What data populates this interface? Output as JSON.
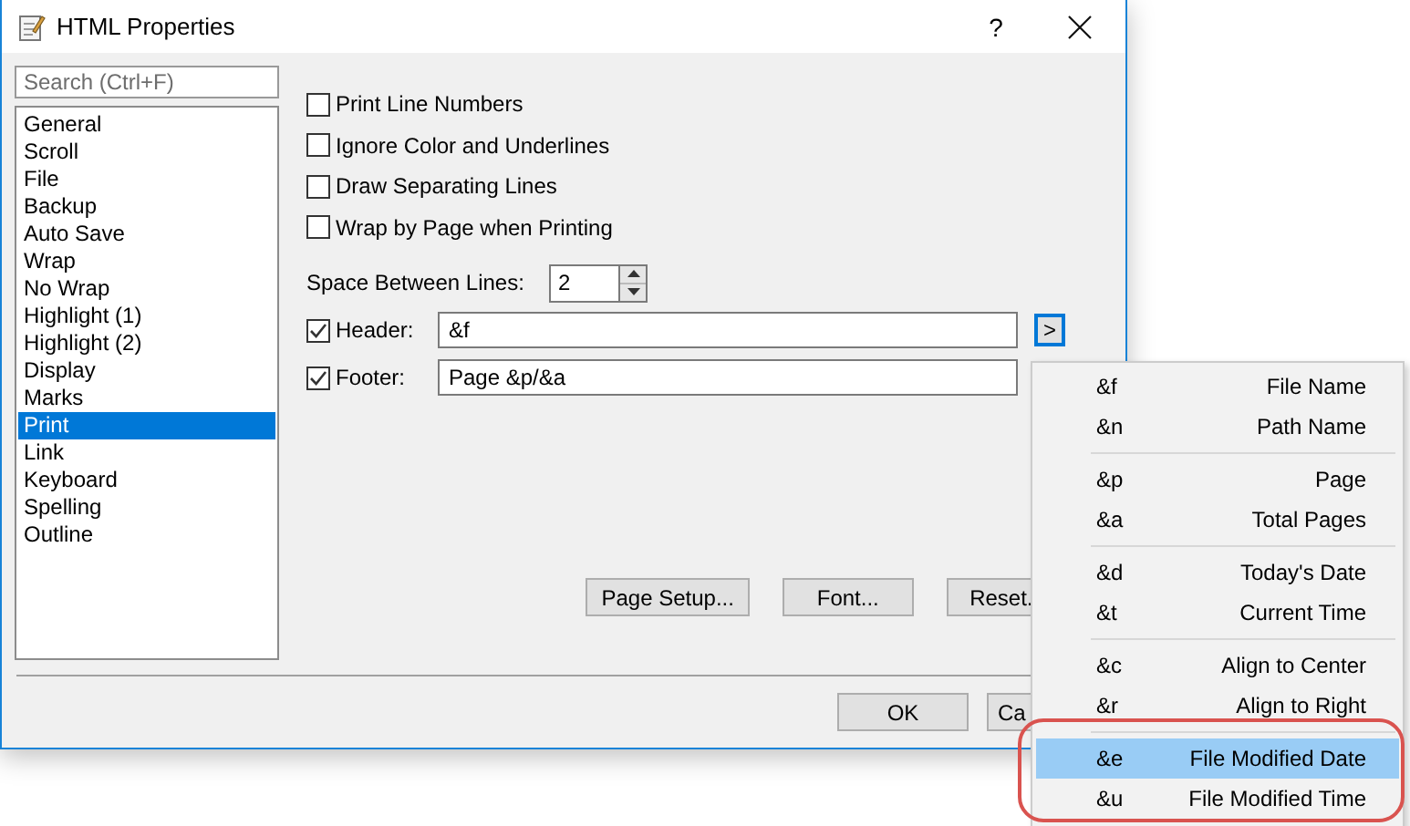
{
  "window": {
    "title": "HTML Properties",
    "help": "?"
  },
  "search": {
    "placeholder": "Search (Ctrl+F)"
  },
  "categories": [
    {
      "label": "General",
      "selected": false
    },
    {
      "label": "Scroll",
      "selected": false
    },
    {
      "label": "File",
      "selected": false
    },
    {
      "label": "Backup",
      "selected": false
    },
    {
      "label": "Auto Save",
      "selected": false
    },
    {
      "label": "Wrap",
      "selected": false
    },
    {
      "label": "No Wrap",
      "selected": false
    },
    {
      "label": "Highlight (1)",
      "selected": false
    },
    {
      "label": "Highlight (2)",
      "selected": false
    },
    {
      "label": "Display",
      "selected": false
    },
    {
      "label": "Marks",
      "selected": false
    },
    {
      "label": "Print",
      "selected": true
    },
    {
      "label": "Link",
      "selected": false
    },
    {
      "label": "Keyboard",
      "selected": false
    },
    {
      "label": "Spelling",
      "selected": false
    },
    {
      "label": "Outline",
      "selected": false
    }
  ],
  "options": [
    {
      "label": "Print Line Numbers",
      "checked": false
    },
    {
      "label": "Ignore Color and Underlines",
      "checked": false
    },
    {
      "label": "Draw Separating Lines",
      "checked": false
    },
    {
      "label": "Wrap by Page when Printing",
      "checked": false
    }
  ],
  "spacing": {
    "label": "Space Between Lines:",
    "value": "2"
  },
  "header": {
    "label": "Header:",
    "checked": true,
    "value": "&f",
    "menu_button": ">"
  },
  "footer": {
    "label": "Footer:",
    "checked": true,
    "value": "Page &p/&a"
  },
  "panel_buttons": [
    "Page Setup...",
    "Font...",
    "Reset."
  ],
  "dialog_buttons": [
    "OK",
    "Ca"
  ],
  "menu": {
    "groups": [
      [
        {
          "code": "&f",
          "label": "File Name",
          "selected": false
        },
        {
          "code": "&n",
          "label": "Path Name",
          "selected": false
        }
      ],
      [
        {
          "code": "&p",
          "label": "Page",
          "selected": false
        },
        {
          "code": "&a",
          "label": "Total Pages",
          "selected": false
        }
      ],
      [
        {
          "code": "&d",
          "label": "Today's Date",
          "selected": false
        },
        {
          "code": "&t",
          "label": "Current Time",
          "selected": false
        }
      ],
      [
        {
          "code": "&c",
          "label": "Align to Center",
          "selected": false
        },
        {
          "code": "&r",
          "label": "Align to Right",
          "selected": false
        }
      ],
      [
        {
          "code": "&e",
          "label": "File Modified Date",
          "selected": true
        },
        {
          "code": "&u",
          "label": "File Modified Time",
          "selected": false
        }
      ]
    ]
  }
}
